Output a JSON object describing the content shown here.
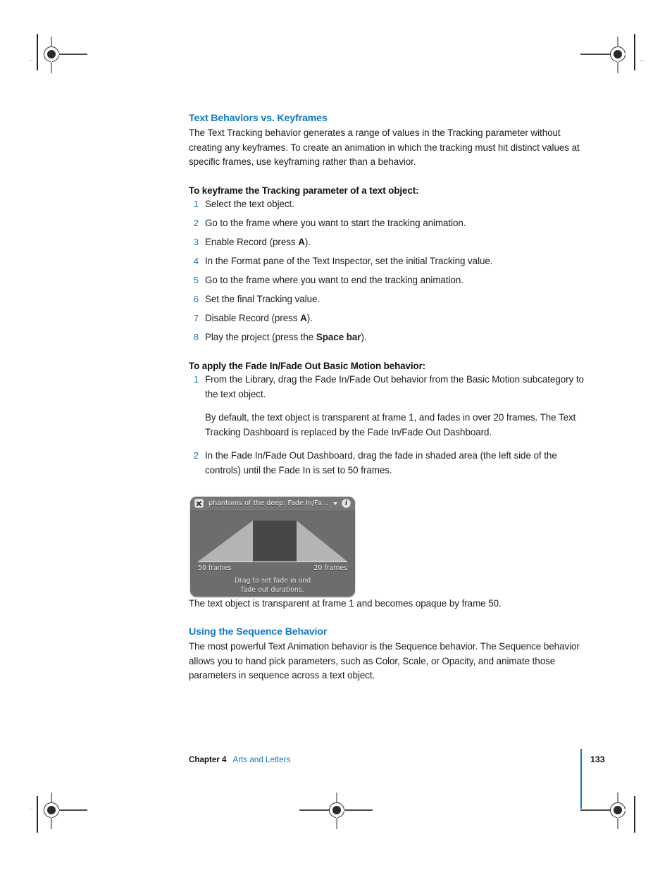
{
  "page": {
    "number": "133",
    "chapter_label": "Chapter 4",
    "chapter_title": "Arts and Letters"
  },
  "sections": [
    {
      "heading": "Text Behaviors vs. Keyframes",
      "body": "The Text Tracking behavior generates a range of values in the Tracking parameter without creating any keyframes. To create an animation in which the tracking must hit distinct values at specific frames, use keyframing rather than a behavior."
    },
    {
      "heading": "Using the Sequence Behavior",
      "body": "The most powerful Text Animation behavior is the Sequence behavior. The Sequence behavior allows you to hand pick parameters, such as Color, Scale, or Opacity, and animate those parameters in sequence across a text object."
    }
  ],
  "procedure_one": {
    "title": "To keyframe the Tracking parameter of a text object:",
    "steps": [
      {
        "num": "1",
        "text": "Select the text object."
      },
      {
        "num": "2",
        "text": "Go to the frame where you want to start the tracking animation."
      },
      {
        "num": "3",
        "text_before": "Enable Record (press ",
        "bold": "A",
        "text_after": ")."
      },
      {
        "num": "4",
        "text": "In the Format pane of the Text Inspector, set the initial Tracking value."
      },
      {
        "num": "5",
        "text": "Go to the frame where you want to end the tracking animation."
      },
      {
        "num": "6",
        "text": "Set the final Tracking value."
      },
      {
        "num": "7",
        "text_before": "Disable Record (press ",
        "bold": "A",
        "text_after": ")."
      },
      {
        "num": "8",
        "text_before": "Play the project (press the ",
        "bold": "Space bar",
        "text_after": ")."
      }
    ]
  },
  "procedure_two": {
    "title": "To apply the Fade In/Fade Out Basic Motion behavior:",
    "step1": {
      "num": "1",
      "text": "From the Library, drag the Fade In/Fade Out behavior from the Basic Motion subcategory to the text object.",
      "note": "By default, the text object is transparent at frame 1, and fades in over 20 frames. The Text Tracking Dashboard is replaced by the Fade In/Fade Out Dashboard."
    },
    "step2": {
      "num": "2",
      "text": "In the Fade In/Fade Out Dashboard, drag the fade in shaded area (the left side of the controls) until the Fade In is set to 50 frames."
    }
  },
  "figure": {
    "title": "phantoms of the deep: Fade In/Fa...",
    "close_icon": "close-x-icon",
    "caret_icon": "chevron-down-icon",
    "info_icon": "info-circle-icon",
    "fade_in_label": "50 frames",
    "fade_out_label": "20 frames",
    "hint_line1": "Drag to set fade in and",
    "hint_line2": "fade out durations.",
    "colors": {
      "panel": "#6d6d6d",
      "titlebar": "#767676",
      "ramp": "#b4b4b4",
      "center": "#474747"
    }
  },
  "caption_after_figure": "The text object is transparent at frame 1 and becomes opaque by frame 50."
}
